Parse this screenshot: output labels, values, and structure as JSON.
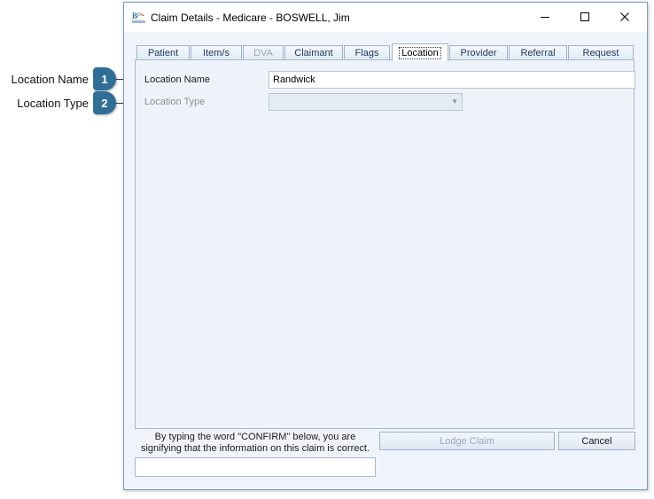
{
  "window": {
    "title": "Claim Details - Medicare - BOSWELL, Jim"
  },
  "callouts": [
    {
      "number": "1",
      "label": "Location Name"
    },
    {
      "number": "2",
      "label": "Location Type"
    }
  ],
  "tabs": [
    {
      "label": "Patient"
    },
    {
      "label": "Item/s"
    },
    {
      "label": "DVA"
    },
    {
      "label": "Claimant"
    },
    {
      "label": "Flags"
    },
    {
      "label": "Location"
    },
    {
      "label": "Provider"
    },
    {
      "label": "Referral"
    },
    {
      "label": "Request"
    }
  ],
  "form": {
    "location_name_label": "Location Name",
    "location_name_value": "Randwick",
    "location_type_label": "Location Type",
    "location_type_value": ""
  },
  "footer": {
    "confirm_line1": "By typing the word \"CONFIRM\" below, you are",
    "confirm_line2": "signifying that the information on this claim is correct.",
    "confirm_value": "",
    "lodge_label": "Lodge Claim",
    "cancel_label": "Cancel"
  },
  "icons": {
    "app": "bp-allied-logo-icon",
    "minimize": "minimize-icon",
    "maximize": "maximize-icon",
    "close": "close-icon",
    "dropdown": "chevron-down-icon"
  },
  "colors": {
    "callout_badge": "#2f6e96",
    "window_border": "#7a9cc0",
    "tab_text": "#1f3b63",
    "panel_bg": "#eef3fa"
  }
}
